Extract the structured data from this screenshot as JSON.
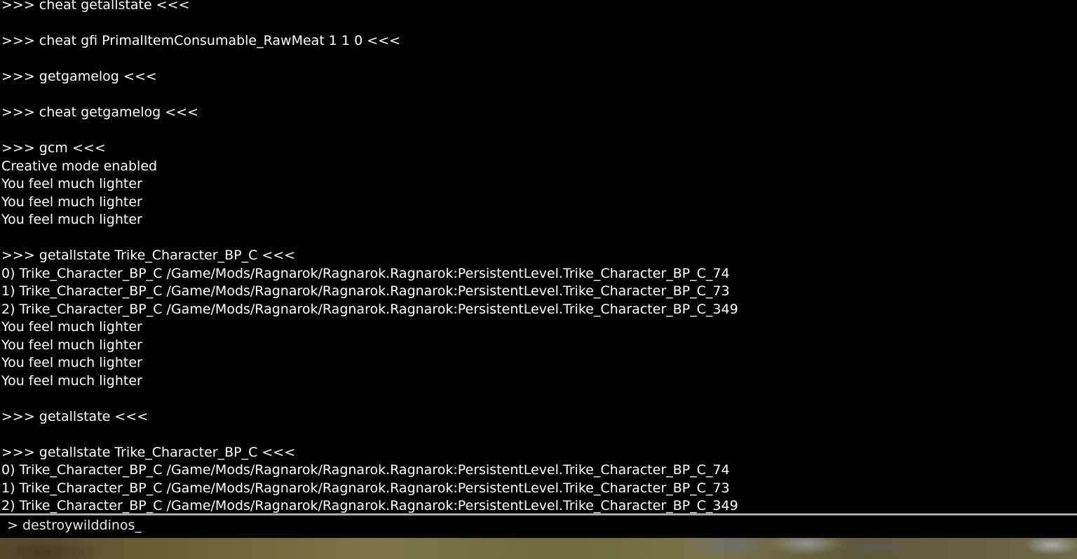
{
  "console": {
    "lines": [
      ">>> cheat getallstate <<<",
      "",
      ">>> cheat gfi PrimalItemConsumable_RawMeat 1 1 0 <<<",
      "",
      ">>> getgamelog <<<",
      "",
      ">>> cheat getgamelog <<<",
      "",
      ">>> gcm <<<",
      "Creative mode enabled",
      "You feel much lighter",
      "You feel much lighter",
      "You feel much lighter",
      "",
      ">>> getallstate Trike_Character_BP_C <<<",
      "0) Trike_Character_BP_C /Game/Mods/Ragnarok/Ragnarok.Ragnarok:PersistentLevel.Trike_Character_BP_C_74",
      "1) Trike_Character_BP_C /Game/Mods/Ragnarok/Ragnarok.Ragnarok:PersistentLevel.Trike_Character_BP_C_73",
      "2) Trike_Character_BP_C /Game/Mods/Ragnarok/Ragnarok.Ragnarok:PersistentLevel.Trike_Character_BP_C_349",
      "You feel much lighter",
      "You feel much lighter",
      "You feel much lighter",
      "You feel much lighter",
      "",
      ">>> getallstate <<<",
      "",
      ">>> getallstate Trike_Character_BP_C <<<",
      "0) Trike_Character_BP_C /Game/Mods/Ragnarok/Ragnarok.Ragnarok:PersistentLevel.Trike_Character_BP_C_74",
      "1) Trike_Character_BP_C /Game/Mods/Ragnarok/Ragnarok.Ragnarok:PersistentLevel.Trike_Character_BP_C_73",
      "2) Trike_Character_BP_C /Game/Mods/Ragnarok/Ragnarok.Ragnarok:PersistentLevel.Trike_Character_BP_C_349"
    ],
    "input": {
      "prompt": ">",
      "value": "destroywilddinos_"
    },
    "colors": {
      "background": "#000000",
      "text": "#ffffff",
      "divider": "#b0b0b0"
    }
  }
}
